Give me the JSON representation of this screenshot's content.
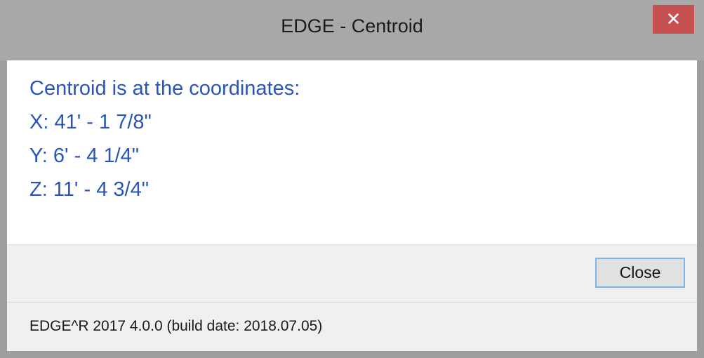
{
  "window": {
    "title": "EDGE - Centroid",
    "close_glyph": "✕"
  },
  "message": {
    "heading": "Centroid is at the coordinates:",
    "x_line": "X: 41' - 1 7/8\"",
    "y_line": "Y: 6' - 4 1/4\"",
    "z_line": "Z: 11' - 4 3/4\""
  },
  "buttons": {
    "close_label": "Close"
  },
  "status": {
    "text": "EDGE^R 2017 4.0.0 (build date: 2018.07.05)"
  },
  "colors": {
    "message_text": "#2a55b8",
    "close_button_bg": "#c75050"
  }
}
